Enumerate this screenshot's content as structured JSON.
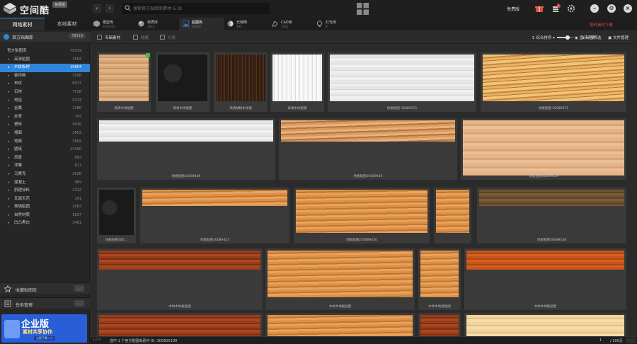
{
  "app": {
    "title": "空间酷",
    "badge": "免费版",
    "search_placeholder": "搜索官方贴图库素材 & ID",
    "vip_label": "免费版",
    "notif_count": "1"
  },
  "sidebar": {
    "tabs": [
      "网络素材",
      "本地素材"
    ],
    "library_name": "官方贴图库",
    "library_count": "78319",
    "categories": [
      {
        "name": "官方贴图库",
        "count": "78319",
        "root": true
      },
      {
        "name": "高清贴图",
        "count": "3593"
      },
      {
        "name": "木纹板材",
        "count": "10604",
        "selected": true
      },
      {
        "name": "装饰画",
        "count": "3598"
      },
      {
        "name": "布纹",
        "count": "8017"
      },
      {
        "name": "石材",
        "count": "7538"
      },
      {
        "name": "地毯",
        "count": "5274"
      },
      {
        "name": "金属",
        "count": "1286"
      },
      {
        "name": "皮革",
        "count": "743"
      },
      {
        "name": "瓷砖",
        "count": "4916"
      },
      {
        "name": "墙面",
        "count": "3953"
      },
      {
        "name": "地面",
        "count": "3692"
      },
      {
        "name": "壁纸",
        "count": "14390"
      },
      {
        "name": "风景",
        "count": "893"
      },
      {
        "name": "浮雕",
        "count": "817"
      },
      {
        "name": "马赛克",
        "count": "2628"
      },
      {
        "name": "混凝土",
        "count": "989"
      },
      {
        "name": "肌理涂料",
        "count": "2312"
      },
      {
        "name": "瓦面天花",
        "count": "291"
      },
      {
        "name": "玻璃贴图",
        "count": "1083"
      },
      {
        "name": "自然材质",
        "count": "1627"
      },
      {
        "name": "凹凸黑白",
        "count": "3451"
      }
    ],
    "favorites_label": "收藏贴图库",
    "tasks_label": "任务管理",
    "banner": {
      "title": "企业版",
      "subtitle": "素材共享协作",
      "tag": "立即了解 >>"
    }
  },
  "lib_tabs": [
    {
      "name": "模型库",
      "count": "1055325",
      "icon": "cube-icon"
    },
    {
      "name": "材质库",
      "count": "2615",
      "icon": "sphere-icon"
    },
    {
      "name": "贴图库",
      "count": "78319",
      "icon": "image-icon",
      "active": true
    },
    {
      "name": "光域网",
      "count": "595",
      "icon": "light-icon"
    },
    {
      "name": "CAD库",
      "count": "1262",
      "icon": "cad-icon"
    },
    {
      "name": "灯光库",
      "count": "9",
      "icon": "bulb-icon"
    }
  ],
  "promo_text": "限时素材下载",
  "filters": {
    "checkboxes": [
      "专辑素材",
      "收藏",
      "付费"
    ],
    "tag_filter": "标签筛选",
    "sort": "综合排序",
    "show_detail": "显示详情",
    "file_manage": "文件管理"
  },
  "cards": [
    {
      "caption": "高清木纹贴图",
      "tex": "maple",
      "tag": true
    },
    {
      "caption": "高清木纹贴图",
      "tex": "black"
    },
    {
      "caption": "高清胡桃木纹理",
      "tex": "walnut"
    },
    {
      "caption": "高清木纹贴图",
      "tex": "white"
    },
    {
      "caption": "地板贴图 30089472",
      "tex": "whitewide"
    },
    {
      "caption": "地板贴图 30089471",
      "tex": "zebra"
    },
    {
      "caption": "地板贴图30089466",
      "tex": "whitewide"
    },
    {
      "caption": "地板贴图30089465",
      "tex": "teak"
    },
    {
      "caption": "地板贴图30089459",
      "tex": "pale"
    },
    {
      "caption": "地板贴图300...",
      "tex": "black"
    },
    {
      "caption": "地板贴图30089453",
      "tex": "orange"
    },
    {
      "caption": "地板贴图230089450",
      "tex": "orange"
    },
    {
      "caption": "",
      "tex": "orange"
    },
    {
      "caption": "地板贴图30089438",
      "tex": "brown"
    },
    {
      "caption": "木纹木地板贴图",
      "tex": "cherry"
    },
    {
      "caption": "木纹木地板贴图",
      "tex": "orange"
    },
    {
      "caption": "木纹木地板贴图",
      "tex": "orange"
    },
    {
      "caption": "木纹木地板贴图",
      "tex": "redorange"
    },
    {
      "caption": "",
      "tex": "cherry"
    },
    {
      "caption": "",
      "tex": "orange"
    },
    {
      "caption": "",
      "tex": "cherry"
    },
    {
      "caption": "",
      "tex": "birch"
    }
  ],
  "status": {
    "version": "1.0.6",
    "text": "选中 1 个官方贴图库素材 ID: 300825199",
    "page": "1",
    "total": "/ 100页"
  }
}
